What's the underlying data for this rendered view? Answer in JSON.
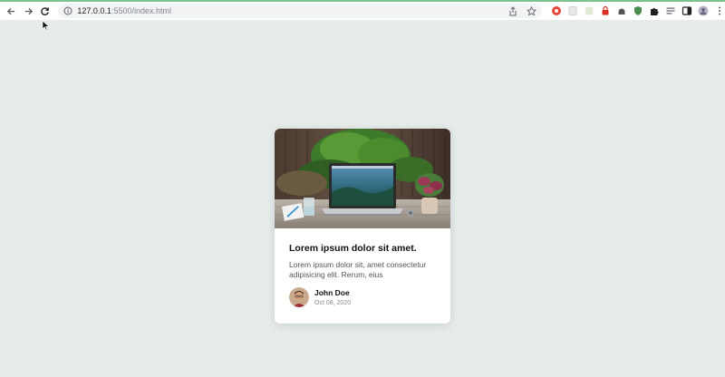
{
  "browser": {
    "url_host": "127.0.0.1",
    "url_path": ":5500/index.html"
  },
  "card": {
    "title": "Lorem ipsum dolor sit amet.",
    "description": "Lorem ipsum dolor sit, amet consectetur adipisicing elit. Rerum, eius",
    "author": {
      "name": "John Doe",
      "date": "Oct 08, 2020"
    }
  },
  "colors": {
    "page_background": "#e6ecea",
    "card_background": "#ffffff",
    "title_text": "#111111",
    "body_text": "#555555",
    "date_text": "#8a8a8a"
  },
  "icons": [
    "back-arrow-icon",
    "forward-arrow-icon",
    "reload-icon",
    "site-info-icon",
    "share-icon",
    "bookmark-star-icon",
    "extensions-puzzle-icon",
    "side-panel-icon",
    "profile-avatar-icon",
    "menu-dots-icon"
  ]
}
